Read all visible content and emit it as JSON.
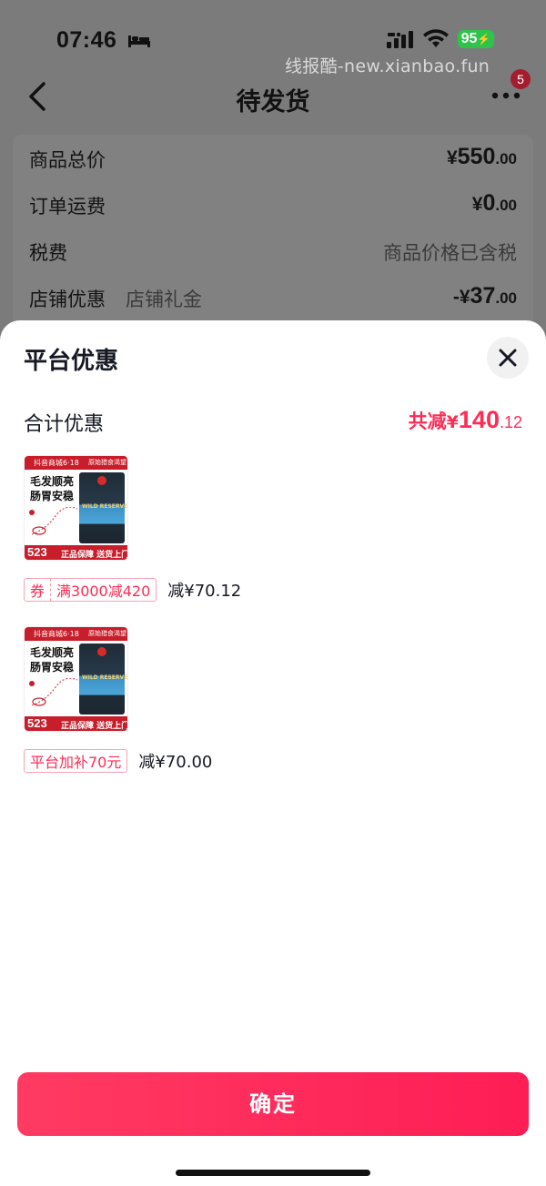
{
  "status_bar": {
    "time": "07:46",
    "battery": "95"
  },
  "watermark": "线报酷-new.xianbao.fun",
  "nav": {
    "title": "待发货",
    "badge": "5"
  },
  "price_summary": {
    "rows": [
      {
        "label": "商品总价",
        "sub": "",
        "currency": "¥",
        "int": "550",
        "dec": ".00"
      },
      {
        "label": "订单运费",
        "sub": "",
        "currency": "¥",
        "int": "0",
        "dec": ".00"
      },
      {
        "label": "税费",
        "sub": "",
        "text": "商品价格已含税"
      },
      {
        "label": "店铺优惠",
        "sub": "店铺礼金",
        "currency": "-¥",
        "int": "37",
        "dec": ".00"
      }
    ]
  },
  "sheet": {
    "title": "平台优惠",
    "total_label": "合计优惠",
    "total_prefix": "共减",
    "total_currency": "¥",
    "total_int": "140",
    "total_dec": ".12"
  },
  "products": [
    {
      "thumb": {
        "top_left": "抖音商城6·18",
        "top_right": "原始猎食渴望",
        "headline": "毛发顺亮肠胃安稳",
        "bag_text": "WILD RESERVE",
        "price": "523",
        "bottom_text": "正品保障 送货上门"
      },
      "tag_prefix": "券",
      "tag_text": "满3000减420",
      "amount": "减¥70.12"
    },
    {
      "thumb": {
        "top_left": "抖音商城6·18",
        "top_right": "原始猎食渴望",
        "headline": "毛发顺亮肠胃安稳",
        "bag_text": "WILD RESERVE",
        "price": "523",
        "bottom_text": "正品保障 送货上门"
      },
      "tag_prefix": "",
      "tag_text": "平台加补70元",
      "amount": "减¥70.00"
    }
  ],
  "confirm_label": "确定",
  "colors": {
    "accent": "#fe2c55",
    "overlay": "#7b7b7c",
    "thumb_red": "#c81e2b"
  }
}
